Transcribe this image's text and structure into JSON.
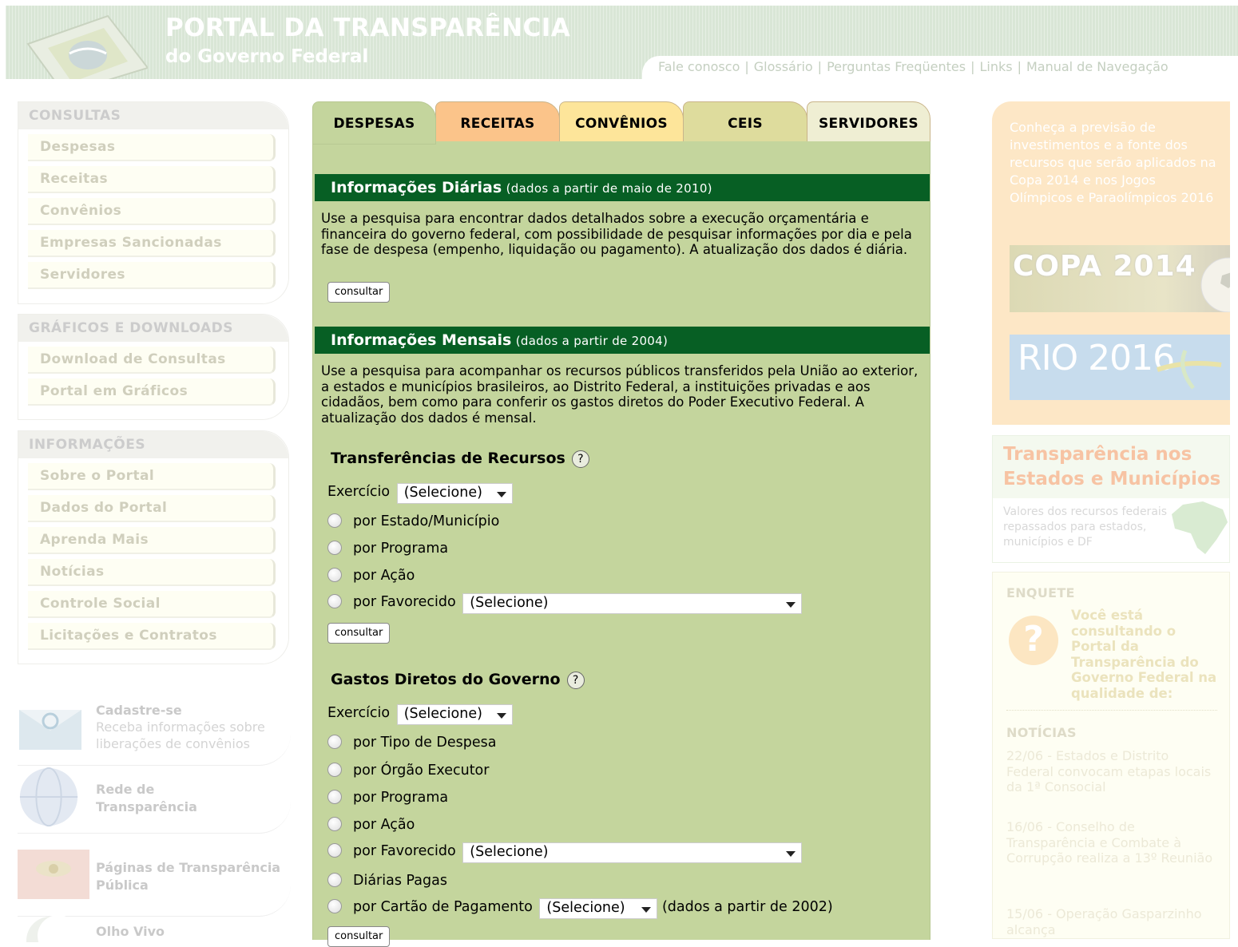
{
  "header": {
    "title": "PORTAL DA TRANSPARÊNCIA",
    "subtitle": "do Governo Federal",
    "links": [
      "Fale conosco",
      "Glossário",
      "Perguntas Freqüentes",
      "Links",
      "Manual de Navegação"
    ]
  },
  "sidebar": {
    "consultas": {
      "title": "CONSULTAS",
      "items": [
        "Despesas",
        "Receitas",
        "Convênios",
        "Empresas Sancionadas",
        "Servidores"
      ]
    },
    "graficos": {
      "title": "GRÁFICOS E DOWNLOADS",
      "items": [
        "Download de Consultas",
        "Portal em Gráficos"
      ]
    },
    "informacoes": {
      "title": "INFORMAÇÕES",
      "items": [
        "Sobre o Portal",
        "Dados do Portal",
        "Aprenda Mais",
        "Notícias",
        "Controle Social",
        "Licitações e Contratos"
      ]
    },
    "promos": [
      {
        "title": "Cadastre-se",
        "text": "Receba informações sobre liberações de convênios"
      },
      {
        "title": "Rede de Transparência"
      },
      {
        "title": "Páginas de Transparência Pública"
      },
      {
        "title": "Olho Vivo"
      }
    ]
  },
  "tabs": [
    "DESPESAS",
    "RECEITAS",
    "CONVÊNIOS",
    "CEIS",
    "SERVIDORES"
  ],
  "tab_colors": [
    "#c4d59d",
    "#fbc48a",
    "#fde59a",
    "#dedc9d",
    "#efeed3"
  ],
  "main": {
    "diarias": {
      "title": "Informações Diárias",
      "note": "(dados a partir de maio de 2010)",
      "text": "Use a pesquisa para encontrar dados detalhados sobre a execução orçamentária e financeira do governo federal, com possibilidade de pesquisar informações por dia e pela fase de despesa (empenho, liquidação ou pagamento). A atualização dos dados é diária.",
      "button": "consultar"
    },
    "mensais": {
      "title": "Informações Mensais",
      "note": "(dados a partir de 2004)",
      "text": "Use a pesquisa para acompanhar os recursos públicos transferidos pela União ao exterior, a estados e municípios brasileiros, ao Distrito Federal, a instituições privadas e aos cidadãos, bem como para conferir os gastos diretos do Poder Executivo Federal. A atualização dos dados é mensal."
    },
    "transferencias": {
      "title": "Transferências de Recursos",
      "help": "?",
      "exercicio_label": "Exercício",
      "exercicio_value": "(Selecione)",
      "options": [
        "por Estado/Município",
        "por Programa",
        "por Ação",
        "por Favorecido"
      ],
      "favorecido_value": "(Selecione)",
      "button": "consultar"
    },
    "gastos": {
      "title": "Gastos Diretos do Governo",
      "help": "?",
      "exercicio_label": "Exercício",
      "exercicio_value": "(Selecione)",
      "options": [
        "por Tipo de Despesa",
        "por Órgão Executor",
        "por Programa",
        "por Ação",
        "por Favorecido",
        "Diárias Pagas",
        "por Cartão de Pagamento"
      ],
      "favorecido_value": "(Selecione)",
      "cartao_value": "(Selecione)",
      "cartao_note": "(dados a partir de 2002)",
      "button": "consultar"
    }
  },
  "right": {
    "olympic": {
      "text": "Conheça a previsão de investimentos e a fonte dos recursos que serão aplicados na Copa 2014 e nos Jogos Olímpicos e Paraolímpicos 2016",
      "copa": "COPA 2014",
      "rio": "RIO 2016"
    },
    "estados": {
      "title": "Transparência nos Estados e Municípios",
      "text": "Valores dos recursos federais repassados para estados, municípios e DF"
    },
    "enquete": {
      "title": "ENQUETE",
      "question": "Você está consultando o Portal da Transparência do Governo Federal na qualidade de:",
      "icon": "?"
    },
    "noticias": {
      "title": "NOTÍCIAS",
      "items": [
        "22/06 - Estados e Distrito Federal convocam etapas locais da 1ª Consocial",
        "16/06 - Conselho de Transparência e Combate à Corrupção realiza a 13º Reunião",
        "15/06 - Operação Gasparzinho alcança"
      ]
    }
  }
}
